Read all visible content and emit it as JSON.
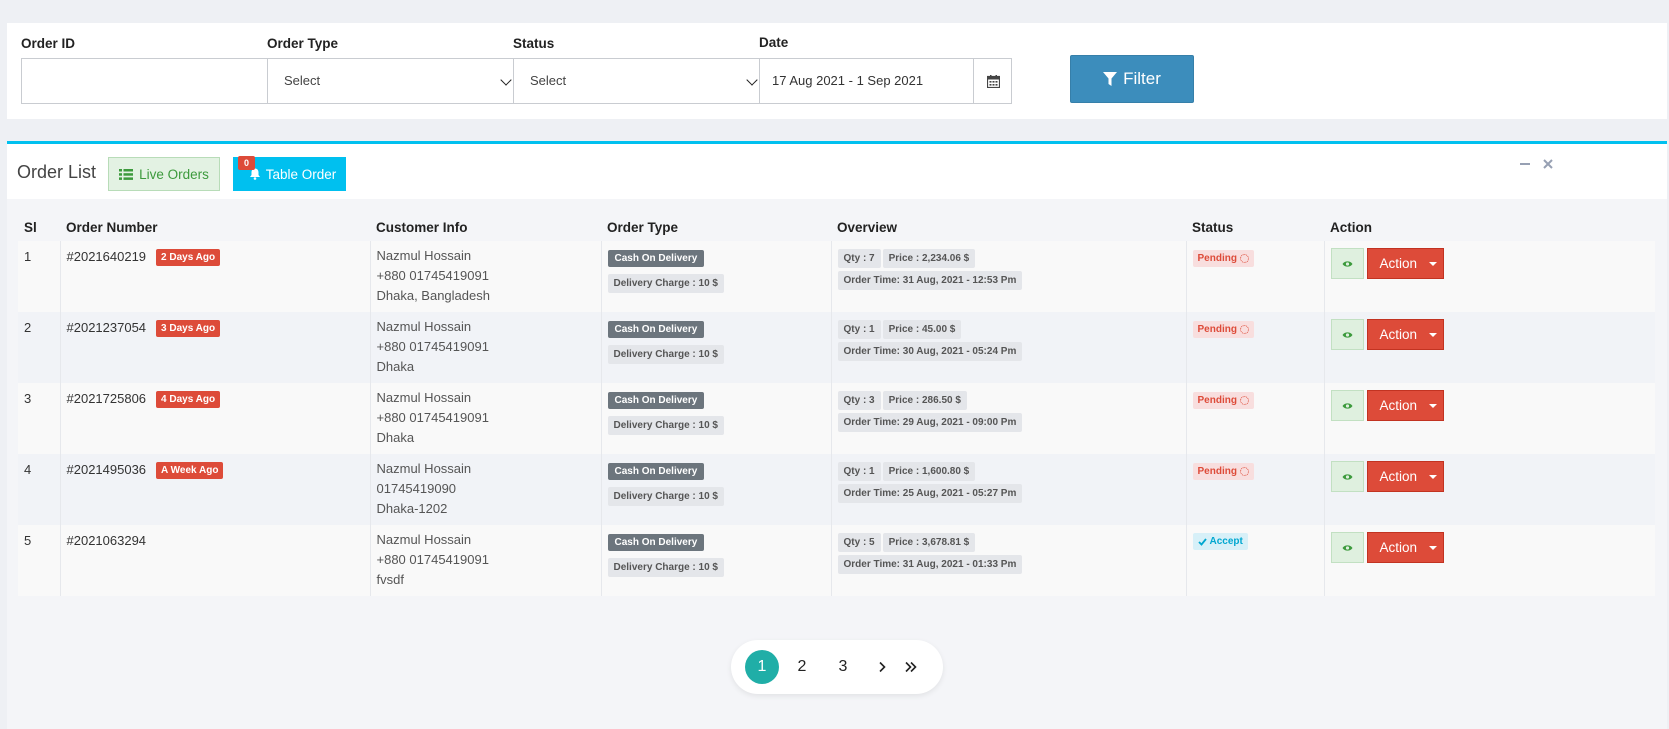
{
  "filters": {
    "order_id_label": "Order ID",
    "order_id_value": "",
    "order_type_label": "Order Type",
    "order_type_value": "Select",
    "status_label": "Status",
    "status_value": "Select",
    "date_label": "Date",
    "date_value": "17 Aug 2021 - 1 Sep 2021",
    "filter_button": "Filter"
  },
  "order_list": {
    "title": "Order List",
    "live_orders_button": "Live Orders",
    "table_order_button": "Table Order",
    "table_order_count": "0"
  },
  "table": {
    "headers": [
      "Sl",
      "Order Number",
      "Customer Info",
      "Order Type",
      "Overview",
      "Status",
      "Action"
    ],
    "rows": [
      {
        "sl": "1",
        "order_number": "#2021640219",
        "ago": "2 Days Ago",
        "customer": [
          "Nazmul Hossain",
          "+880 01745419091",
          "Dhaka, Bangladesh"
        ],
        "order_type": "Cash On Delivery",
        "delivery_charge": "Delivery Charge : 10 $",
        "qty": "Qty : 7",
        "price": "Price : 2,234.06 $",
        "order_time": "Order Time: 31 Aug, 2021 - 12:53 Pm",
        "status": "Pending",
        "action": "Action"
      },
      {
        "sl": "2",
        "order_number": "#2021237054",
        "ago": "3 Days Ago",
        "customer": [
          "Nazmul Hossain",
          "+880 01745419091",
          "Dhaka"
        ],
        "order_type": "Cash On Delivery",
        "delivery_charge": "Delivery Charge : 10 $",
        "qty": "Qty : 1",
        "price": "Price : 45.00 $",
        "order_time": "Order Time: 30 Aug, 2021 - 05:24 Pm",
        "status": "Pending",
        "action": "Action"
      },
      {
        "sl": "3",
        "order_number": "#2021725806",
        "ago": "4 Days Ago",
        "customer": [
          "Nazmul Hossain",
          "+880 01745419091",
          "Dhaka"
        ],
        "order_type": "Cash On Delivery",
        "delivery_charge": "Delivery Charge : 10 $",
        "qty": "Qty : 3",
        "price": "Price : 286.50 $",
        "order_time": "Order Time: 29 Aug, 2021 - 09:00 Pm",
        "status": "Pending",
        "action": "Action"
      },
      {
        "sl": "4",
        "order_number": "#2021495036",
        "ago": "A Week Ago",
        "customer": [
          "Nazmul Hossain",
          "01745419090",
          "Dhaka-1202"
        ],
        "order_type": "Cash On Delivery",
        "delivery_charge": "Delivery Charge : 10 $",
        "qty": "Qty : 1",
        "price": "Price : 1,600.80 $",
        "order_time": "Order Time: 25 Aug, 2021 - 05:27 Pm",
        "status": "Pending",
        "action": "Action"
      },
      {
        "sl": "5",
        "order_number": "#2021063294",
        "ago": "",
        "customer": [
          "Nazmul Hossain",
          "+880 01745419091",
          "fvsdf"
        ],
        "order_type": "Cash On Delivery",
        "delivery_charge": "Delivery Charge : 10 $",
        "qty": "Qty : 5",
        "price": "Price : 3,678.81 $",
        "order_time": "Order Time: 31 Aug, 2021 - 01:33 Pm",
        "status": "Accept",
        "action": "Action"
      }
    ]
  },
  "pagination": {
    "pages": [
      "1",
      "2",
      "3"
    ],
    "current": "1"
  },
  "icons": {
    "calendar": "calendar-icon",
    "filter": "funnel-icon",
    "live_orders": "list-icon",
    "table_order": "bell-icon",
    "collapse": "minus-icon",
    "close": "close-icon",
    "view": "eye-icon",
    "pending": "spinner-icon",
    "accept": "check-icon",
    "next": "chevron-right-icon",
    "last": "double-chevron-right-icon"
  },
  "colors": {
    "primary": "#3c8dbc",
    "info": "#00c0ef",
    "danger": "#dd4b39",
    "success": "#3c9a3c",
    "pagination_active": "#20aea7"
  }
}
